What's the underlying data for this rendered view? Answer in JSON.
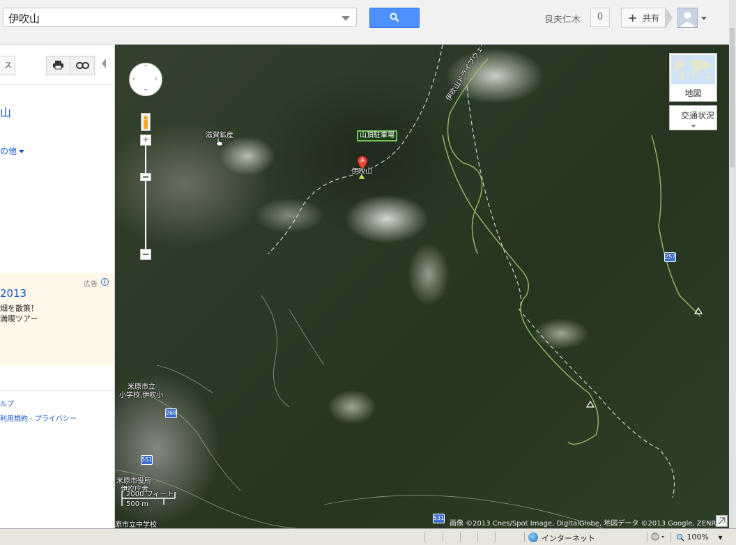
{
  "search": {
    "value": "伊吹山"
  },
  "header": {
    "user_name": "良夫仁木",
    "notification_count": "0",
    "share_label": "共有"
  },
  "sidebar": {
    "tab_label": "ス",
    "place_title": "山",
    "more_label": "の他",
    "ad": {
      "label": "広告",
      "info": "i",
      "title": "2013",
      "line1": "畑を散策！",
      "line2": "満喫ツアー"
    },
    "footer_help": "ルプ",
    "footer_links": "利用規約 - プライバシー"
  },
  "map": {
    "type_label": "地図",
    "traffic_label": "交通状況",
    "labels": {
      "quarry": "滋賀鉱産",
      "parking": "山頂駐車場",
      "peak": "伊吹山",
      "driveway": "伊吹山ドライブウェイ",
      "school": "米原市立 小学校 伊吹小",
      "school_l1": "米原市立",
      "school_l2": "小学校,伊吹小",
      "city_office": "米原市役所",
      "city_office_l2": "伊吹庁舎",
      "junior_high": "原市立中学校"
    },
    "marker_letter": "A",
    "routes": [
      "257",
      "268",
      "551",
      "531"
    ],
    "scale": {
      "feet": "2000 フィート",
      "meters": "500 m"
    },
    "attribution": "画像 ©2013 Cnes/Spot Image, DigitalGlobe, 地図データ ©2013 Google, ZENRIN"
  },
  "statusbar": {
    "zone": "インターネット",
    "zoom": "100%"
  },
  "colors": {
    "accent": "#4d90fe",
    "link": "#1155cc",
    "ad_bg": "#fff8e8"
  }
}
